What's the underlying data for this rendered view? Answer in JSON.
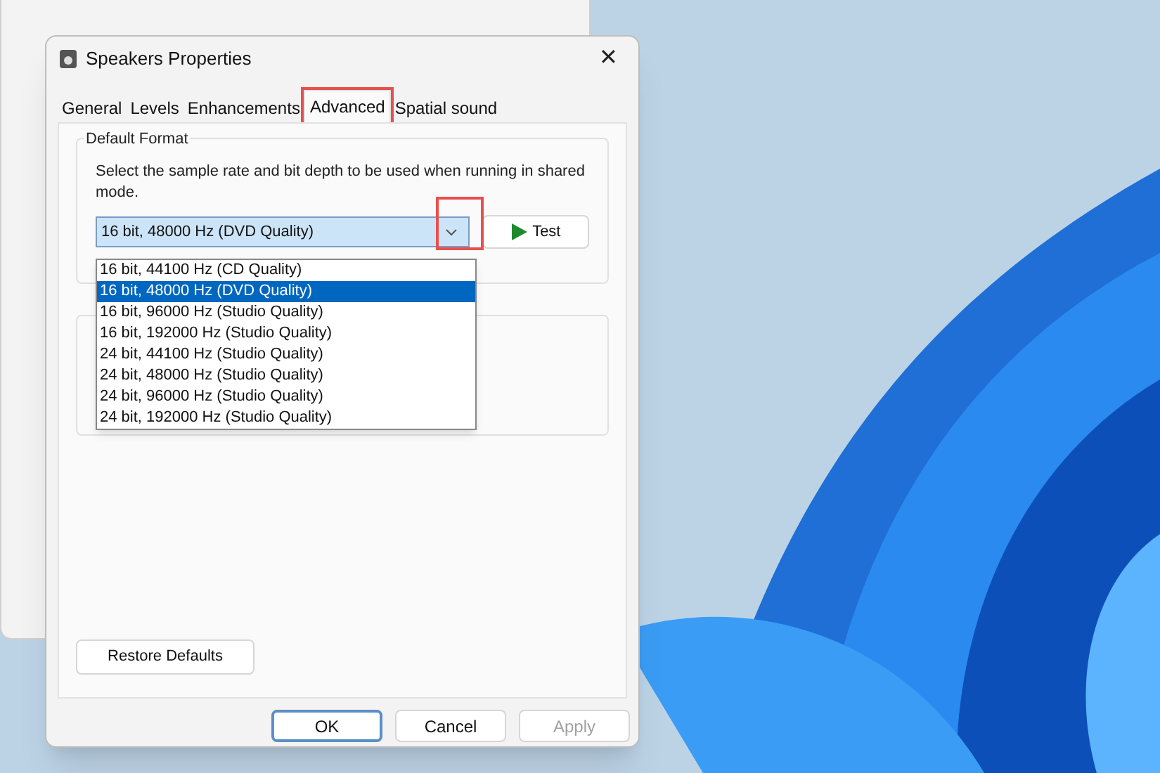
{
  "dialog": {
    "title": "Speakers Properties",
    "close": "✕"
  },
  "tabs": [
    {
      "label": "General",
      "selected": false,
      "highlighted": false
    },
    {
      "label": "Levels",
      "selected": false,
      "highlighted": false
    },
    {
      "label": "Enhancements",
      "selected": false,
      "highlighted": false
    },
    {
      "label": "Advanced",
      "selected": true,
      "highlighted": true
    },
    {
      "label": "Spatial sound",
      "selected": false,
      "highlighted": false
    }
  ],
  "default_format": {
    "heading": "Default Format",
    "description": "Select the sample rate and bit depth to be used when running in shared mode.",
    "combo": {
      "value": "16 bit, 48000 Hz (DVD Quality)",
      "expanded": true,
      "arrow_highlighted": true
    },
    "options": [
      {
        "label": "16 bit, 44100 Hz (CD Quality)",
        "selected": false
      },
      {
        "label": "16 bit, 48000 Hz (DVD Quality)",
        "selected": true
      },
      {
        "label": "16 bit, 96000 Hz (Studio Quality)",
        "selected": false
      },
      {
        "label": "16 bit, 192000 Hz (Studio Quality)",
        "selected": false
      },
      {
        "label": "24 bit, 44100 Hz (Studio Quality)",
        "selected": false
      },
      {
        "label": "24 bit, 48000 Hz (Studio Quality)",
        "selected": false
      },
      {
        "label": "24 bit, 96000 Hz (Studio Quality)",
        "selected": false
      },
      {
        "label": "24 bit, 192000 Hz (Studio Quality)",
        "selected": false
      }
    ],
    "test_button": "Test"
  },
  "restore_button": "Restore Defaults",
  "buttons": [
    {
      "label": "OK",
      "kind": "default",
      "disabled": false
    },
    {
      "label": "Cancel",
      "kind": "normal",
      "disabled": false
    },
    {
      "label": "Apply",
      "kind": "normal",
      "disabled": true
    }
  ]
}
